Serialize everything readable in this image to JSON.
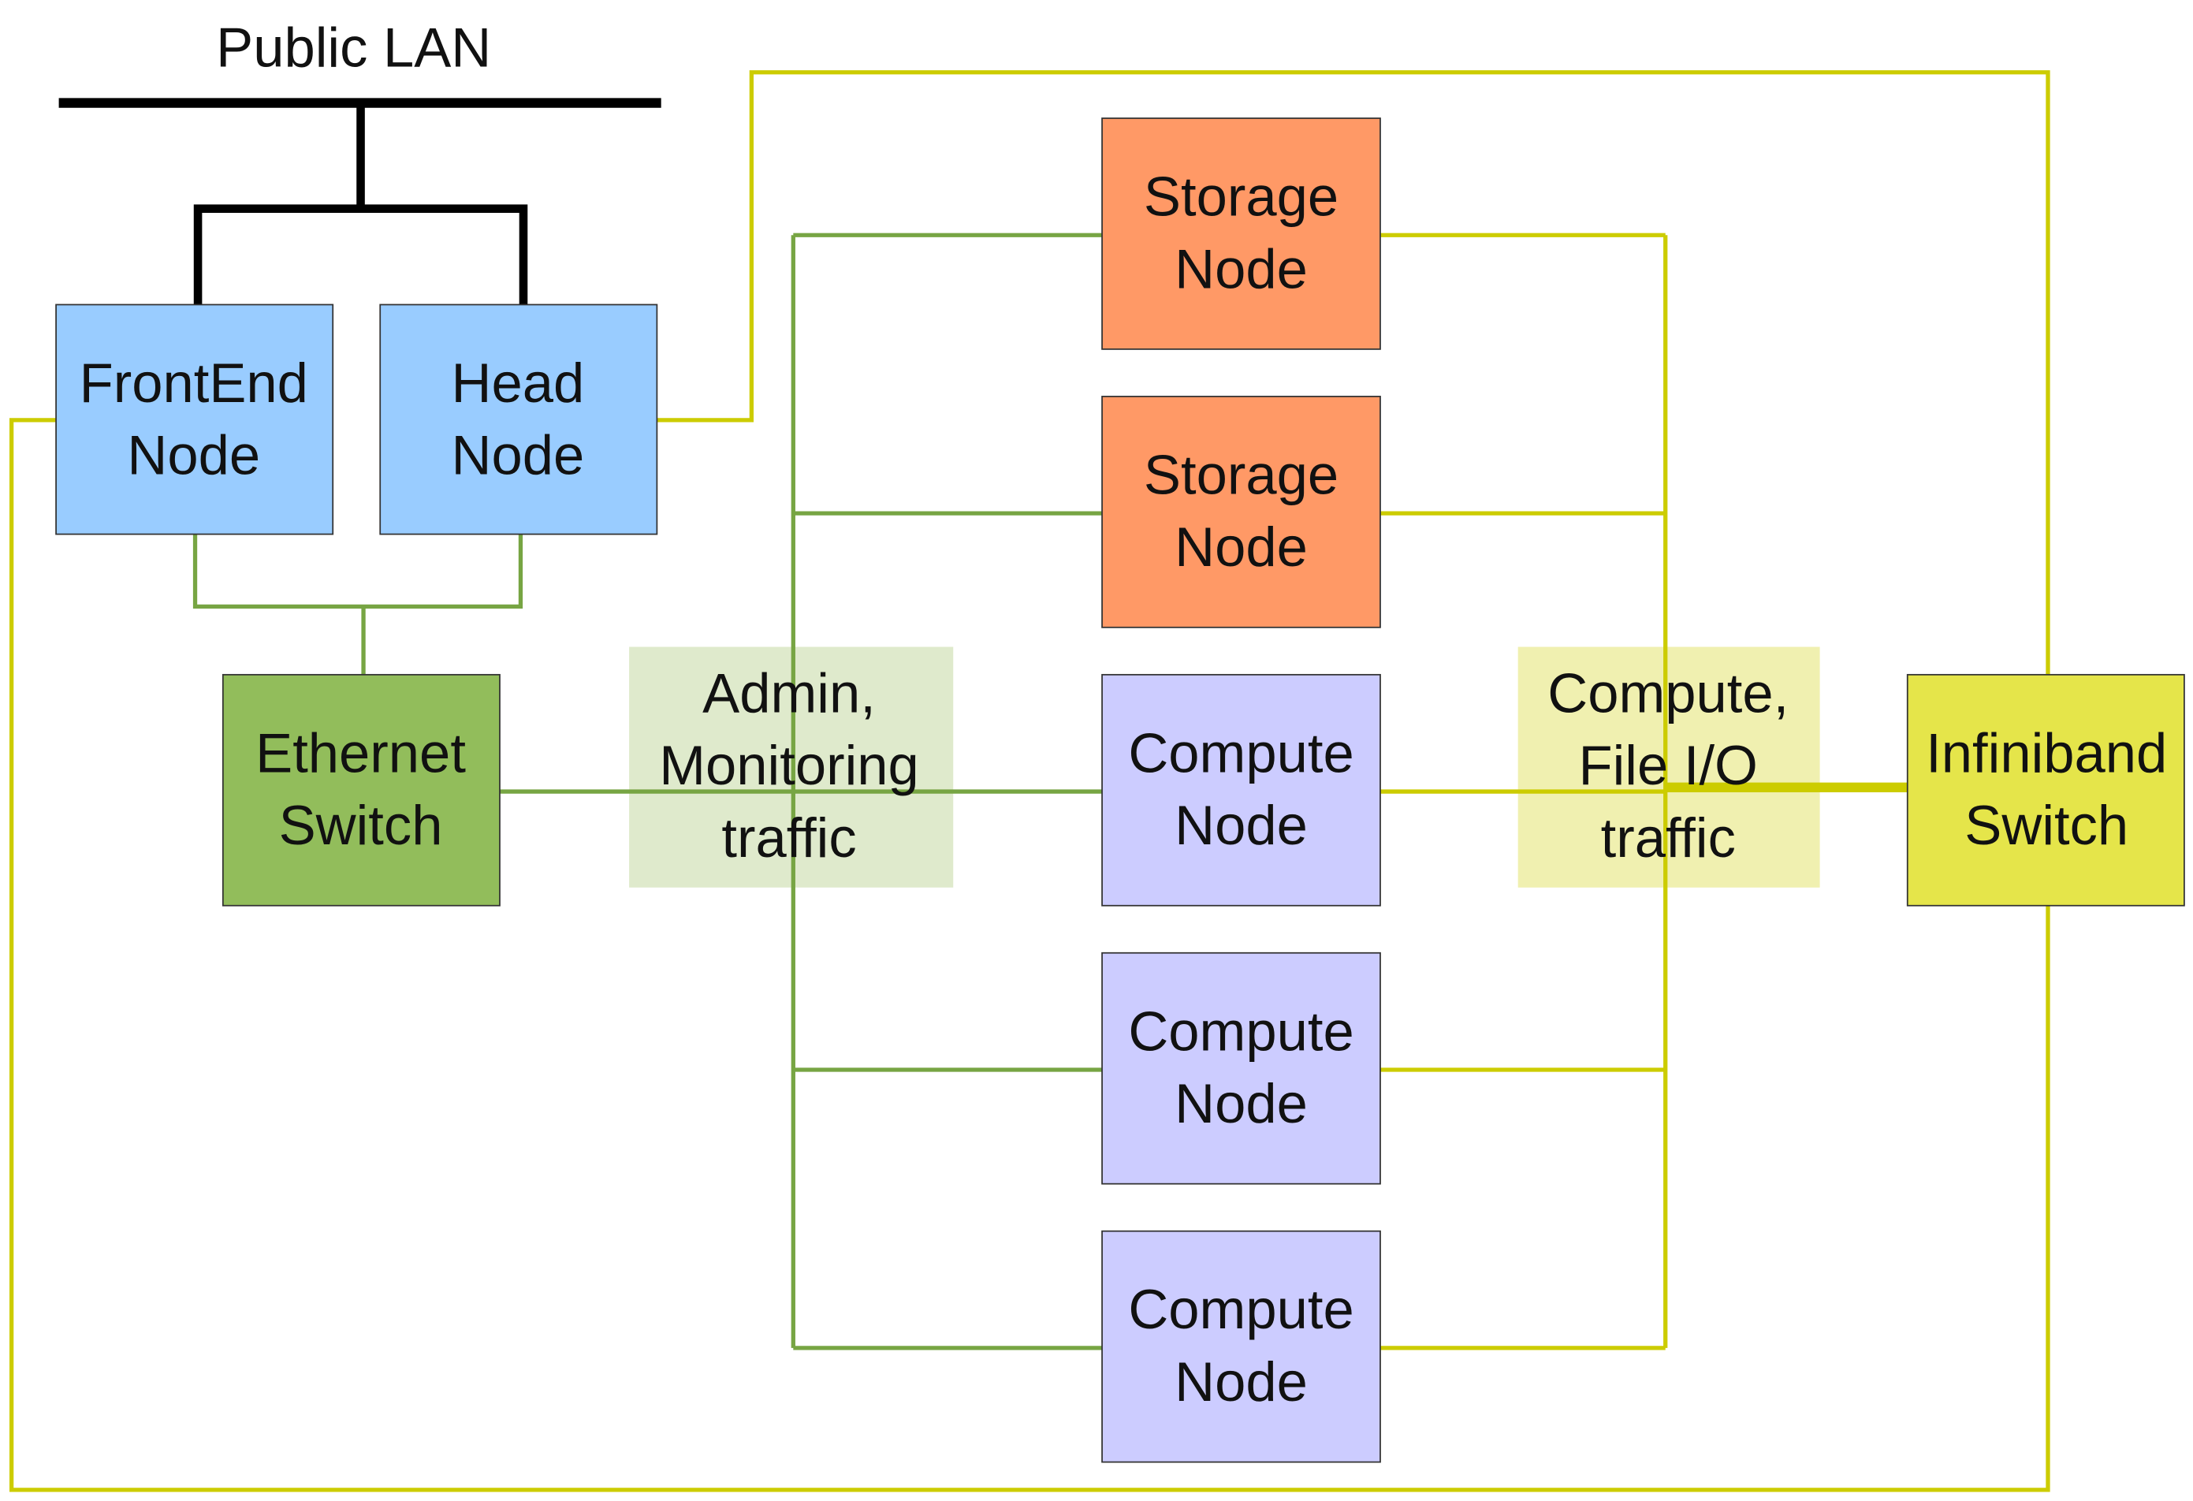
{
  "title": "Public LAN",
  "colors": {
    "lan": "#000000",
    "ethernet_link": "#77a543",
    "infiniband_link": "#cccc00",
    "frontend_fill": "#99ccff",
    "storage_fill": "#ff9966",
    "compute_fill": "#ccccff",
    "ethernet_fill": "#92bd5b",
    "infiniband_fill": "#e5e54a",
    "admin_label_fill": "#dfeacc",
    "compute_label_fill": "#f0f0b0"
  },
  "nodes": {
    "frontend": [
      "FrontEnd",
      "Node"
    ],
    "head": [
      "Head",
      "Node"
    ],
    "ethernet_switch": [
      "Ethernet",
      "Switch"
    ],
    "infiniband_switch": [
      "Infiniband",
      "Switch"
    ],
    "storage_1": [
      "Storage",
      "Node"
    ],
    "storage_2": [
      "Storage",
      "Node"
    ],
    "compute_1": [
      "Compute",
      "Node"
    ],
    "compute_2": [
      "Compute",
      "Node"
    ],
    "compute_3": [
      "Compute",
      "Node"
    ]
  },
  "traffic_labels": {
    "admin": [
      "Admin,",
      "Monitoring",
      "traffic"
    ],
    "compute": [
      "Compute,",
      "File I/O",
      "traffic"
    ]
  }
}
